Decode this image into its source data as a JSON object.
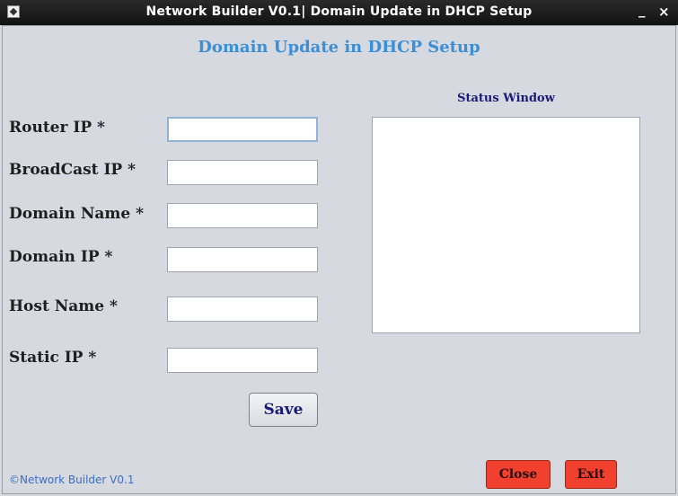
{
  "window": {
    "title": "Network Builder V0.1| Domain Update in DHCP Setup",
    "minimize_label": "_",
    "close_label": "×"
  },
  "heading": "Domain Update in DHCP Setup",
  "form": {
    "router_ip_label": "Router IP *",
    "router_ip_value": "",
    "broadcast_ip_label": "BroadCast IP *",
    "broadcast_ip_value": "",
    "domain_name_label": "Domain Name *",
    "domain_name_value": "",
    "domain_ip_label": "Domain IP *",
    "domain_ip_value": "",
    "host_name_label": "Host Name *",
    "host_name_value": "",
    "static_ip_label": "Static IP *",
    "static_ip_value": "",
    "save_label": "Save"
  },
  "status": {
    "label": "Status Window",
    "content": ""
  },
  "buttons": {
    "close_label": "Close",
    "exit_label": "Exit"
  },
  "footer": "©Network Builder V0.1",
  "colors": {
    "heading": "#3b8fd6",
    "action_red": "#f2402f",
    "footer": "#3a6ec8"
  }
}
